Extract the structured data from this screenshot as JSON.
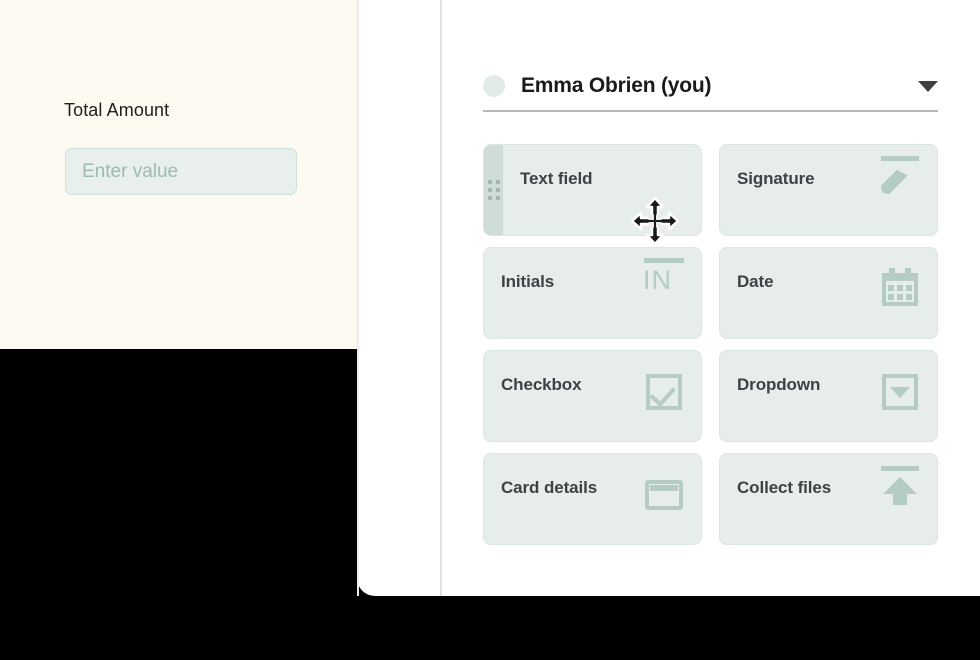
{
  "document_panel": {
    "field_label": "Total Amount",
    "input_placeholder": "Enter value",
    "input_value": "",
    "background_color": "#FDFAF2"
  },
  "recipient_selector": {
    "avatar": "recipient-avatar",
    "name": "Emma Obrien (you)",
    "chevron": "chevron-down-icon"
  },
  "field_tiles": [
    {
      "label": "Text field",
      "icon": "drag-handle-icon",
      "has_drag_handle": true,
      "dragging": true
    },
    {
      "label": "Signature",
      "icon": "signature-pen-icon",
      "has_drag_handle": false,
      "dragging": false
    },
    {
      "label": "Initials",
      "icon": "initials-icon",
      "icon_text": "IN",
      "has_drag_handle": false,
      "dragging": false
    },
    {
      "label": "Date",
      "icon": "calendar-icon",
      "has_drag_handle": false,
      "dragging": false
    },
    {
      "label": "Checkbox",
      "icon": "checkbox-icon",
      "has_drag_handle": false,
      "dragging": false
    },
    {
      "label": "Dropdown",
      "icon": "dropdown-caret-icon",
      "has_drag_handle": false,
      "dragging": false
    },
    {
      "label": "Card details",
      "icon": "credit-card-icon",
      "has_drag_handle": false,
      "dragging": false
    },
    {
      "label": "Collect files",
      "icon": "upload-arrow-icon",
      "has_drag_handle": false,
      "dragging": false
    }
  ],
  "cursor": {
    "type": "move-cursor"
  },
  "colors": {
    "document_bg": "#FDFAF2",
    "panel_bg": "#FFFFFF",
    "tile_bg": "#E6EDEA",
    "tile_border": "#DCE6E2",
    "tile_text": "#3C4246",
    "icon_sage": "#B4CCC3",
    "drag_handle_bg": "#CEDED7",
    "input_bg": "#E8EFEC",
    "placeholder": "#9CBCAF",
    "outer_bg": "#000000"
  }
}
